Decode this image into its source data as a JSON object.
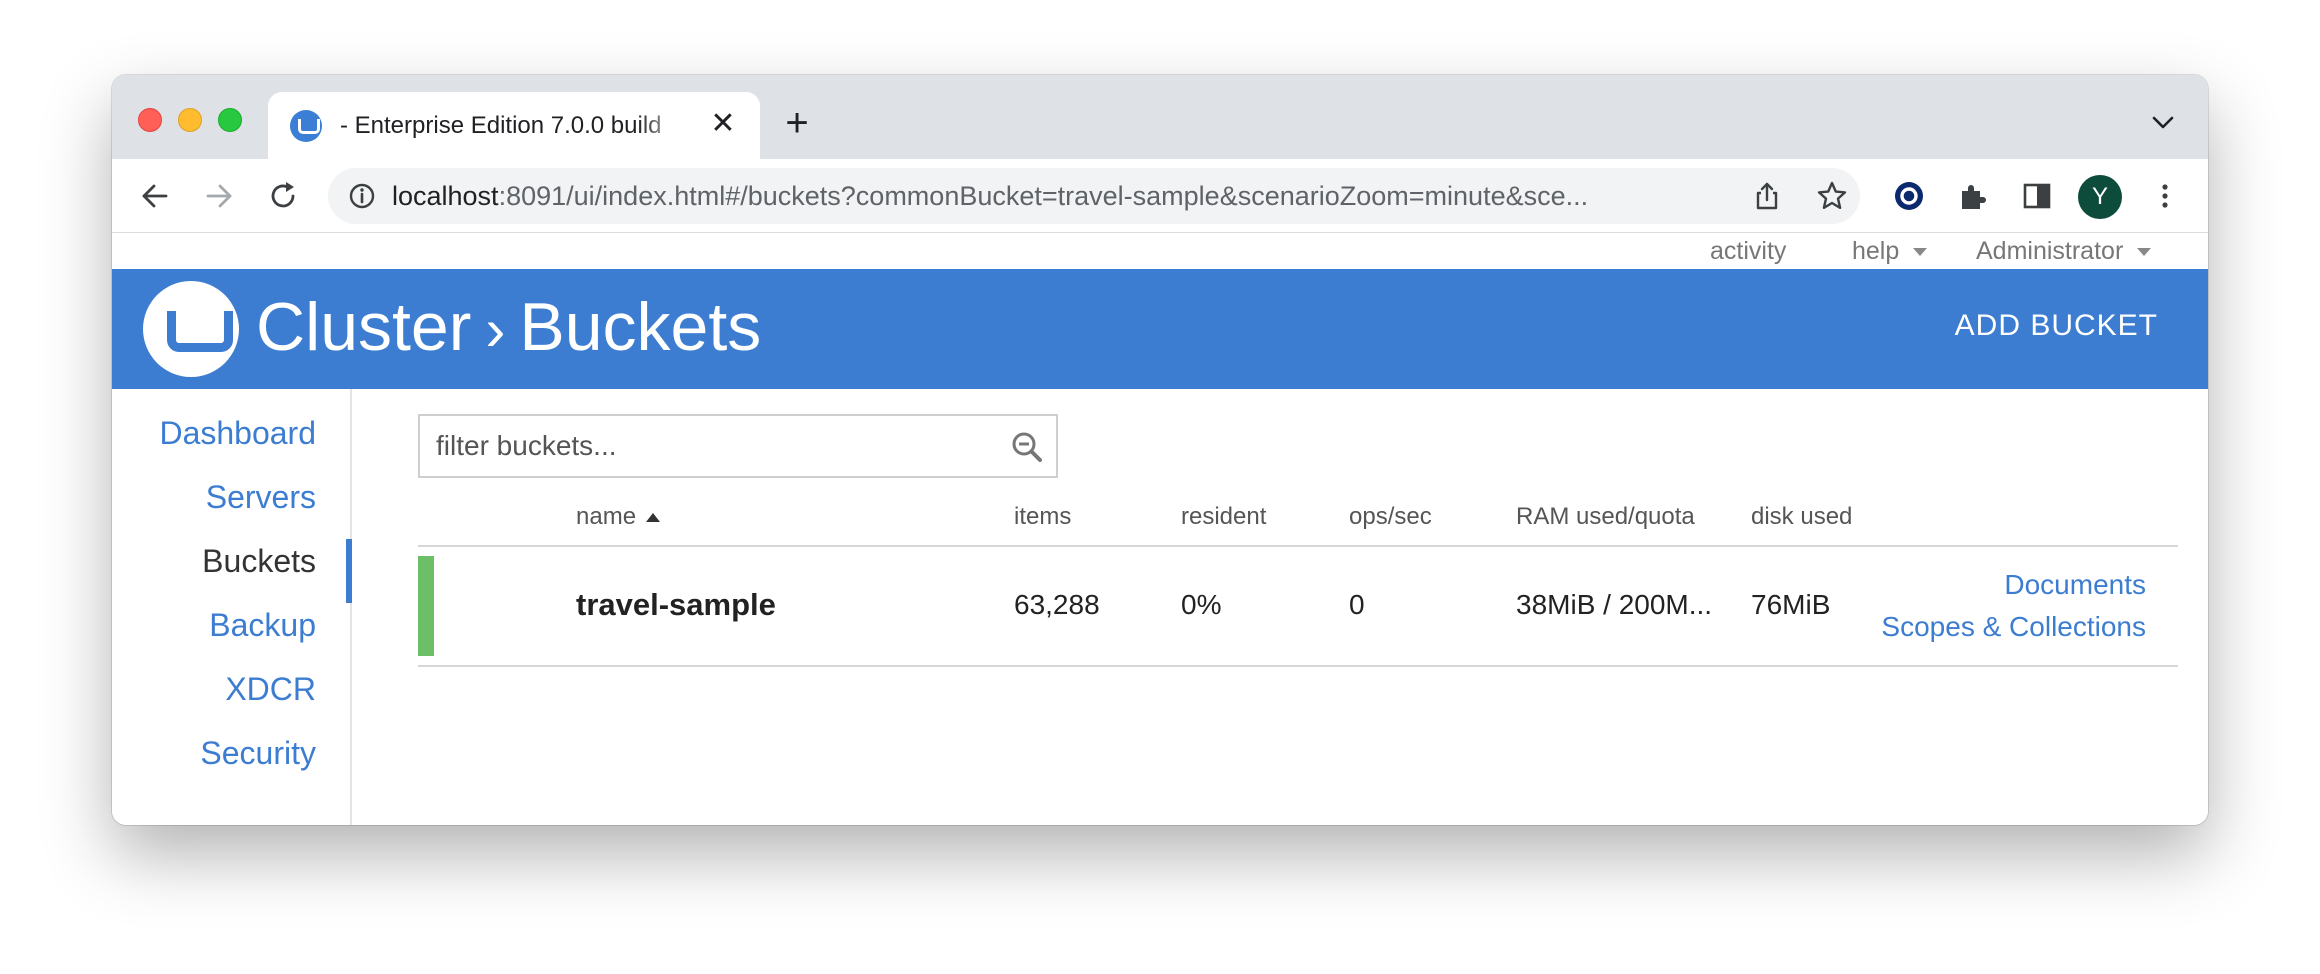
{
  "browser": {
    "tab_title": "- Enterprise Edition 7.0.0 build",
    "tab_close": "✕",
    "new_tab": "+",
    "url_host": "localhost",
    "url_rest": ":8091/ui/index.html#/buckets?commonBucket=travel-sample&scenarioZoom=minute&sce...",
    "profile_initial": "Y"
  },
  "util_menu": {
    "activity": "activity",
    "help": "help",
    "user": "Administrator"
  },
  "header": {
    "title_parent": "Cluster",
    "title_separator": "›",
    "title_current": "Buckets",
    "add_bucket": "ADD BUCKET"
  },
  "sidebar": {
    "items": [
      {
        "label": "Dashboard",
        "active": false
      },
      {
        "label": "Servers",
        "active": false
      },
      {
        "label": "Buckets",
        "active": true
      },
      {
        "label": "Backup",
        "active": false
      },
      {
        "label": "XDCR",
        "active": false
      },
      {
        "label": "Security",
        "active": false
      }
    ]
  },
  "filter": {
    "placeholder": "filter buckets..."
  },
  "table": {
    "columns": [
      "name",
      "items",
      "resident",
      "ops/sec",
      "RAM used/quota",
      "disk used"
    ],
    "sort_column": "name",
    "sort_direction": "ascending",
    "rows": [
      {
        "name": "travel-sample",
        "items": "63,288",
        "resident": "0%",
        "ops_sec": "0",
        "ram": "38MiB / 200M...",
        "disk": "76MiB",
        "status_color": "#6dbf67",
        "links": [
          "Documents",
          "Scopes & Collections"
        ]
      }
    ]
  },
  "colors": {
    "accent": "#3c7dd1",
    "healthy": "#6dbf67"
  }
}
